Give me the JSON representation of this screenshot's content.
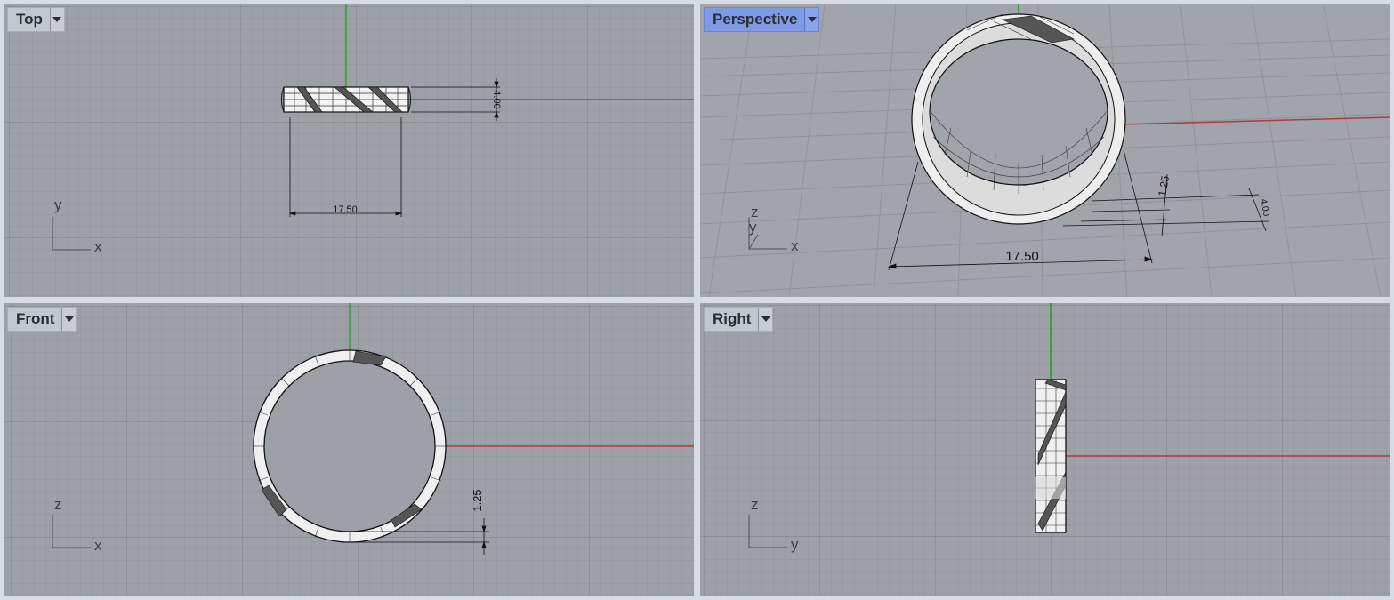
{
  "viewports": {
    "top": {
      "title": "Top",
      "axis_h": "x",
      "axis_v": "y",
      "dim_width": "17.50",
      "dim_height": "4.00"
    },
    "perspective": {
      "title": "Perspective",
      "axis_h": "x",
      "axis_v": "z",
      "axis_d": "y",
      "dim_width": "17.50",
      "dim_height": "4.00",
      "dim_thickness": "1.25"
    },
    "front": {
      "title": "Front",
      "axis_h": "x",
      "axis_v": "z",
      "dim_thickness": "1.25"
    },
    "right": {
      "title": "Right",
      "axis_h": "y",
      "axis_v": "z"
    }
  },
  "colors": {
    "background": "#9da1a7",
    "grid_minor": "#8f949b",
    "grid_major": "#7e838a",
    "x_axis": "#b23a3a",
    "y_axis": "#2fa02f",
    "active_label": "#7e9ae4"
  },
  "icons": {
    "viewport_menu": "triangle-down-icon"
  }
}
